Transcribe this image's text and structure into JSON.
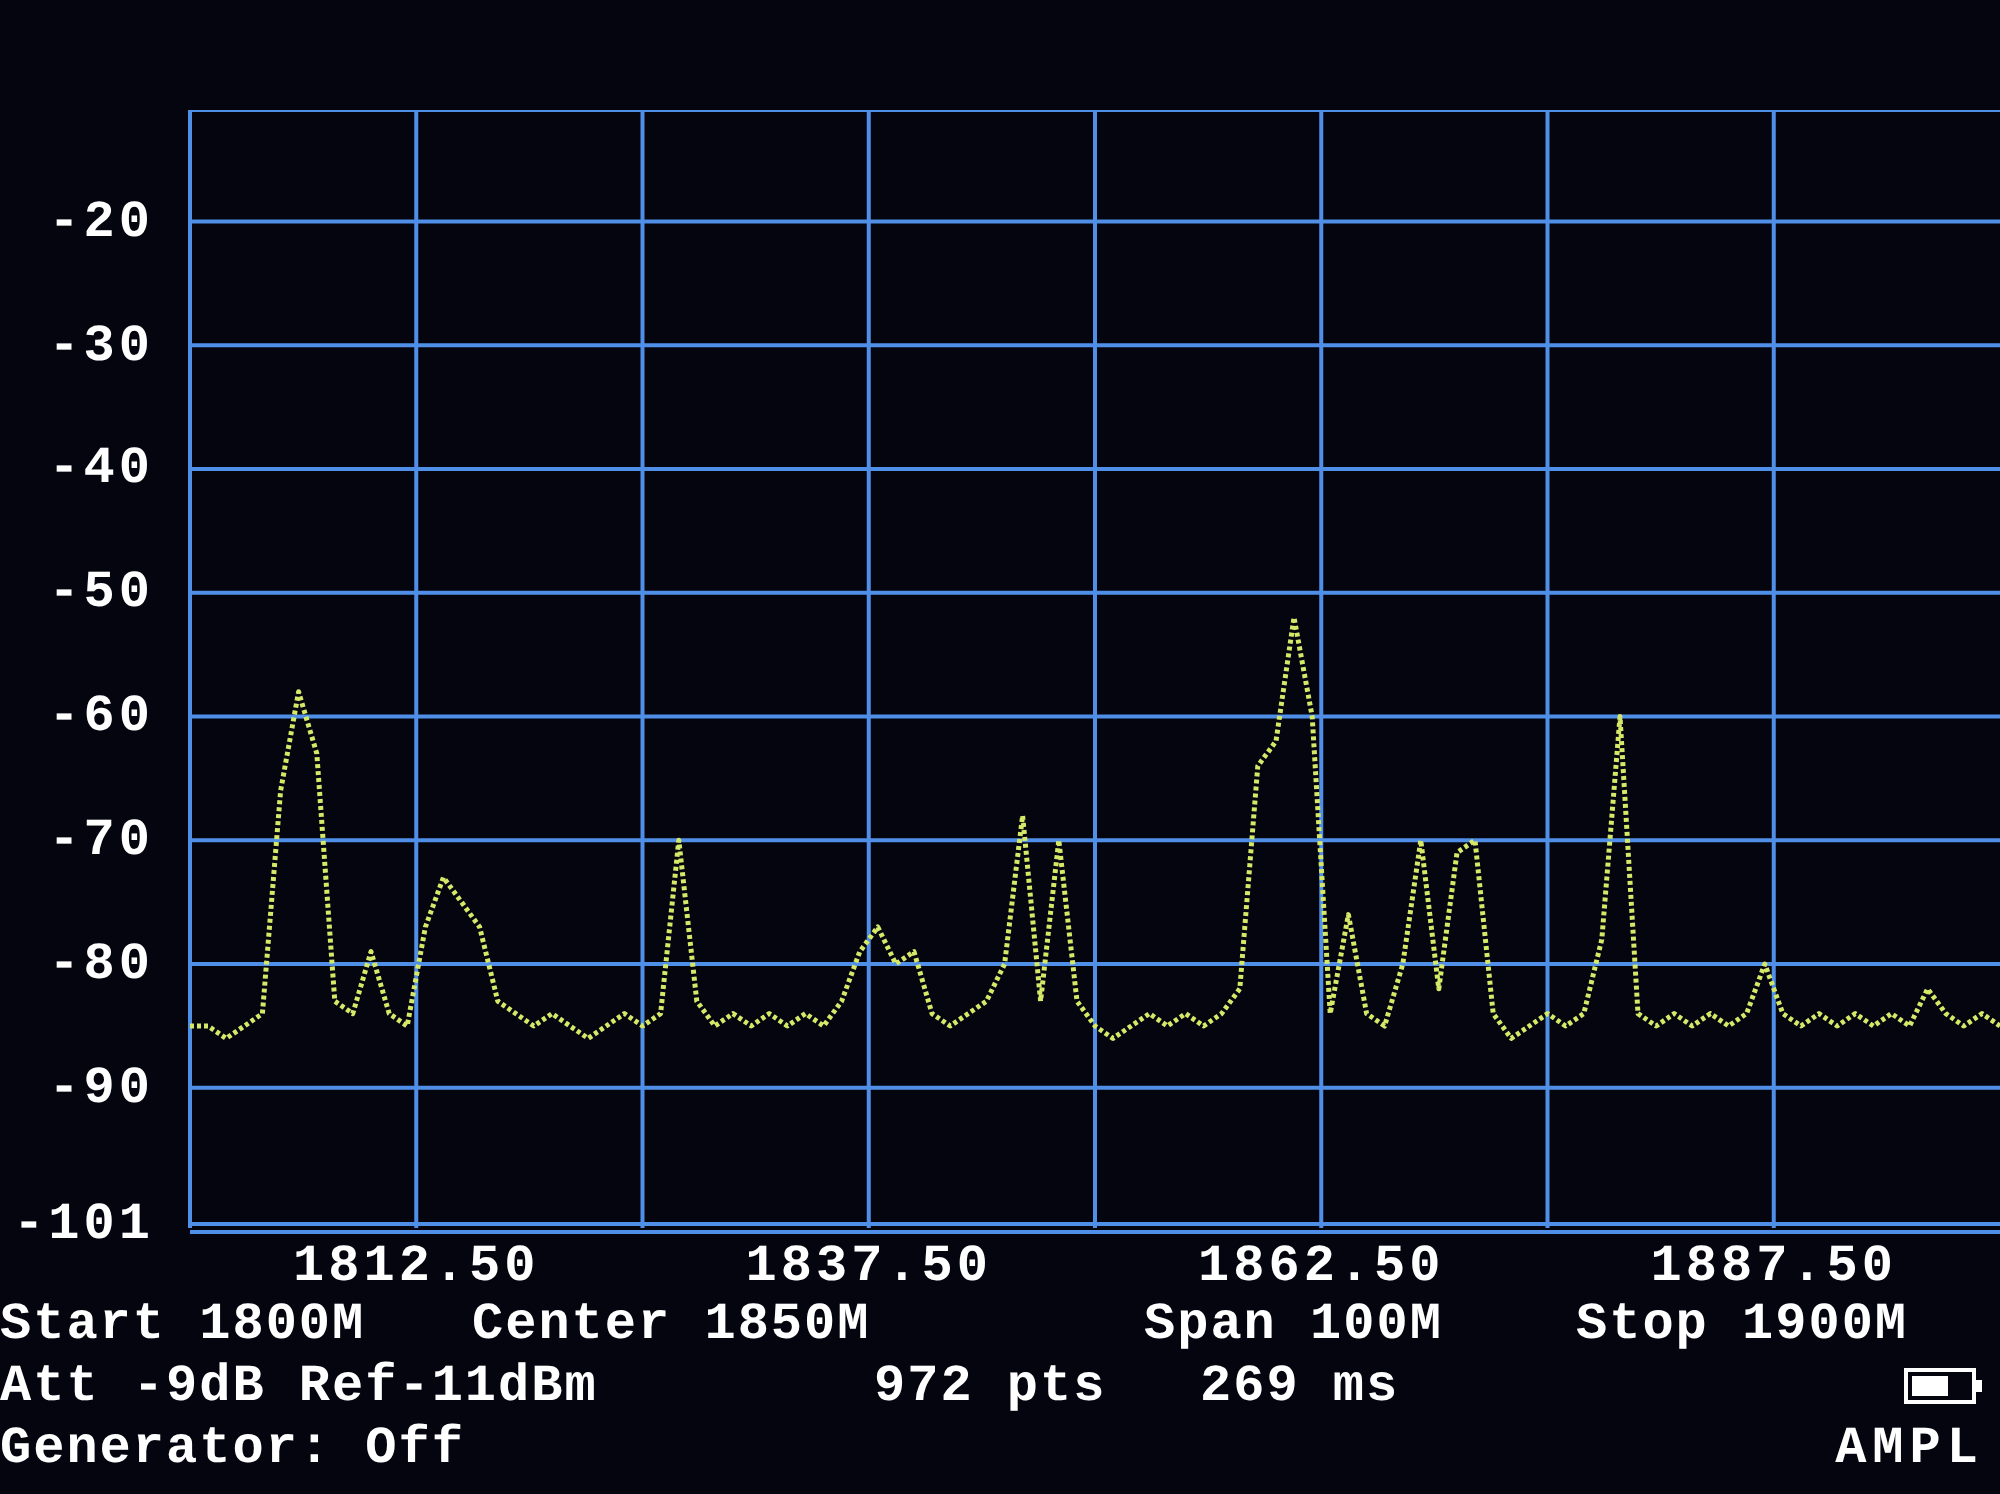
{
  "spectrum": {
    "chart_data": {
      "type": "line",
      "xlim": [
        1800,
        1900
      ],
      "ylim": [
        -101,
        -11
      ],
      "xticks": [
        {
          "value": 1812.5,
          "label": "1812.50"
        },
        {
          "value": 1837.5,
          "label": "1837.50"
        },
        {
          "value": 1862.5,
          "label": "1862.50"
        },
        {
          "value": 1887.5,
          "label": "1887.50"
        }
      ],
      "yticks": [
        -20,
        -30,
        -40,
        -50,
        -60,
        -70,
        -80,
        -90,
        -101
      ],
      "x": [
        1800,
        1801,
        1802,
        1803,
        1804,
        1805,
        1806,
        1807,
        1808,
        1809,
        1810,
        1811,
        1812,
        1813,
        1814,
        1815,
        1816,
        1817,
        1818,
        1819,
        1820,
        1821,
        1822,
        1823,
        1824,
        1825,
        1826,
        1827,
        1828,
        1829,
        1830,
        1831,
        1832,
        1833,
        1834,
        1835,
        1836,
        1837,
        1838,
        1839,
        1840,
        1841,
        1842,
        1843,
        1844,
        1845,
        1846,
        1847,
        1848,
        1849,
        1850,
        1851,
        1852,
        1853,
        1854,
        1855,
        1856,
        1857,
        1858,
        1859,
        1860,
        1861,
        1862,
        1863,
        1864,
        1865,
        1866,
        1867,
        1868,
        1869,
        1870,
        1871,
        1872,
        1873,
        1874,
        1875,
        1876,
        1877,
        1878,
        1879,
        1880,
        1881,
        1882,
        1883,
        1884,
        1885,
        1886,
        1887,
        1888,
        1889,
        1890,
        1891,
        1892,
        1893,
        1894,
        1895,
        1896,
        1897,
        1898,
        1899,
        1900
      ],
      "grid": true,
      "series": [
        {
          "color": "#d6e868",
          "line_style": "dotted",
          "values": [
            -85,
            -85,
            -86,
            -85,
            -84,
            -66,
            -58,
            -63,
            -83,
            -84,
            -79,
            -84,
            -85,
            -77,
            -73,
            -75,
            -77,
            -83,
            -84,
            -85,
            -84,
            -85,
            -86,
            -85,
            -84,
            -85,
            -84,
            -70,
            -83,
            -85,
            -84,
            -85,
            -84,
            -85,
            -84,
            -85,
            -83,
            -79,
            -77,
            -80,
            -79,
            -84,
            -85,
            -84,
            -83,
            -80,
            -68,
            -83,
            -70,
            -83,
            -85,
            -86,
            -85,
            -84,
            -85,
            -84,
            -85,
            -84,
            -82,
            -64,
            -62,
            -52,
            -60,
            -84,
            -76,
            -84,
            -85,
            -80,
            -70,
            -82,
            -71,
            -70,
            -84,
            -86,
            -85,
            -84,
            -85,
            -84,
            -78,
            -60,
            -84,
            -85,
            -84,
            -85,
            -84,
            -85,
            -84,
            -80,
            -84,
            -85,
            -84,
            -85,
            -84,
            -85,
            -84,
            -85,
            -82,
            -84,
            -85,
            -84,
            -85
          ]
        }
      ]
    }
  },
  "settings": [
    [
      "Start 1800M",
      "Center 1850M",
      "Span 100M",
      "Stop 1900M"
    ],
    [
      "Att -9dB Ref-11dBm",
      "972 pts",
      "269 ms"
    ],
    [
      "Generator: Off"
    ]
  ],
  "mode_label": "AMPL"
}
